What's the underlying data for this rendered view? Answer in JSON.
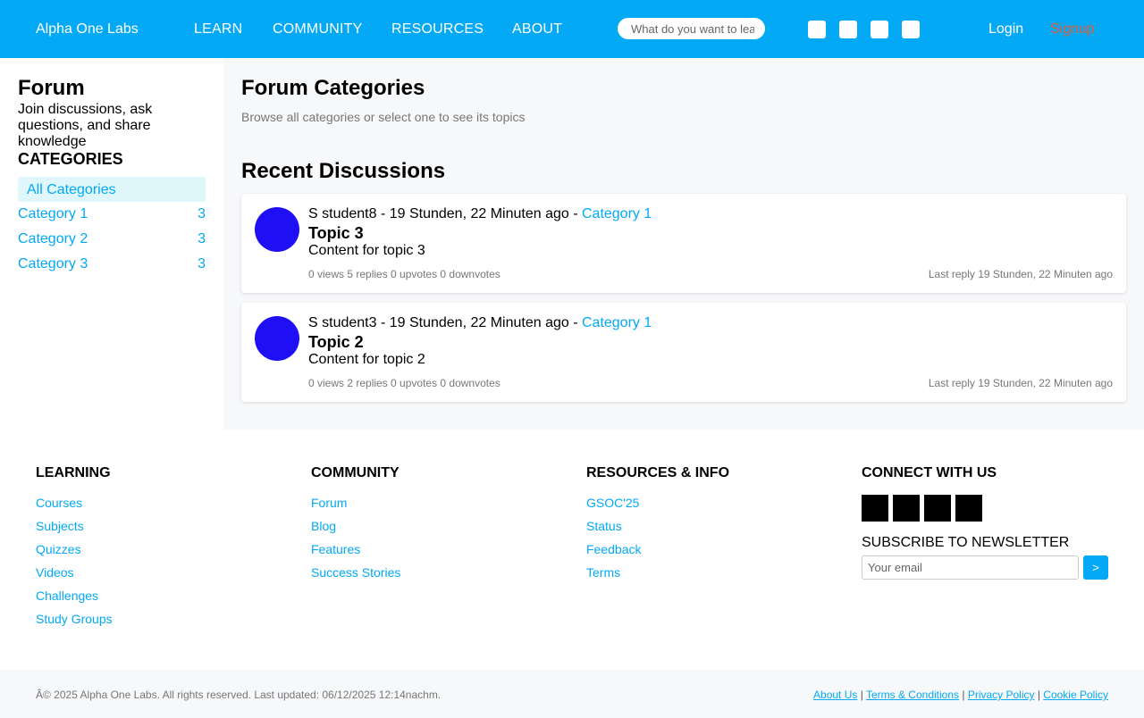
{
  "header": {
    "brand": "Alpha One Labs",
    "nav": [
      "LEARN",
      "COMMUNITY",
      "RESOURCES",
      "ABOUT"
    ],
    "search_placeholder": "What do you want to learn?",
    "login": "Login",
    "signup": "Signup"
  },
  "sidebar": {
    "title": "Forum",
    "description": "Join discussions, ask questions, and share knowledge",
    "categories_heading": "CATEGORIES",
    "all_label": "All Categories",
    "categories": [
      {
        "name": "Category 1",
        "count": "3"
      },
      {
        "name": "Category 2",
        "count": "3"
      },
      {
        "name": "Category 3",
        "count": "3"
      }
    ]
  },
  "main": {
    "title": "Forum Categories",
    "subtitle": "Browse all categories or select one to see its topics",
    "recent_title": "Recent Discussions",
    "topics": [
      {
        "author": "S student8 - 19 Stunden, 22 Minuten ago - ",
        "category": "Category 1",
        "title": "Topic 3",
        "content": "Content for topic 3",
        "stats": "0 views 5 replies 0 upvotes 0 downvotes",
        "last_reply": "Last reply 19 Stunden, 22 Minuten ago"
      },
      {
        "author": "S student3 - 19 Stunden, 22 Minuten ago - ",
        "category": "Category 1",
        "title": "Topic 2",
        "content": "Content for topic 2",
        "stats": "0 views 2 replies 0 upvotes 0 downvotes",
        "last_reply": "Last reply 19 Stunden, 22 Minuten ago"
      }
    ]
  },
  "footer": {
    "learning": {
      "heading": "LEARNING",
      "links": [
        "Courses",
        "Subjects",
        "Quizzes",
        "Videos",
        "Challenges",
        "Study Groups"
      ]
    },
    "community": {
      "heading": "COMMUNITY",
      "links": [
        "Forum",
        "Blog",
        "Features",
        "Success Stories"
      ]
    },
    "resources": {
      "heading": "RESOURCES & INFO",
      "links": [
        "GSOC'25",
        "Status",
        "Feedback",
        "Terms"
      ]
    },
    "connect": {
      "heading": "CONNECT WITH US"
    },
    "newsletter": {
      "title": "SUBSCRIBE TO NEWSLETTER",
      "placeholder": "Your email",
      "button": ">"
    },
    "copyright": "Â© 2025 Alpha One Labs. All rights reserved. Last updated: 06/12/2025 12:14nachm.",
    "legal": [
      "About Us",
      "Terms & Conditions",
      "Privacy Policy",
      "Cookie Policy"
    ],
    "separator": " | "
  },
  "colors": {
    "accent": "#03a9f4",
    "signup": "#e0603d",
    "avatar": "#1e0ff5"
  }
}
